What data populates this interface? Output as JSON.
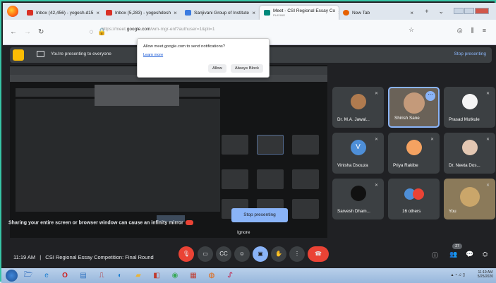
{
  "browser": {
    "tabs": [
      {
        "label": "Inbox (42,456) - yogesh.d15",
        "color": "#d93025"
      },
      {
        "label": "Inbox (5,283) - yogeshdesh",
        "color": "#d93025"
      },
      {
        "label": "Sanjivani Group of Institute",
        "color": "#3b7be0"
      },
      {
        "label": "Meet - CSI Regional Essay Co",
        "sub": "PLAYING",
        "color": "#00897b"
      },
      {
        "label": "New Tab",
        "color": "#e66000"
      }
    ],
    "url_prefix": "https://meet.",
    "url_domain": "google.com",
    "url_suffix": "/wm-mgr-enf?authuser=1&pli=1"
  },
  "notification": {
    "question": "Allow meet.google.com to send notifications?",
    "learn_more": "Learn more",
    "allow": "Allow",
    "always_block": "Always Block"
  },
  "banner": {
    "text": "You're presenting to everyone",
    "stop": "Stop presenting"
  },
  "share": {
    "warning": "Sharing your entire screen or browser window can cause an infinity mirror",
    "stop_button": "Stop presenting",
    "ignore": "Ignore"
  },
  "participants": [
    {
      "name": "Dr. M.A. Jawal...",
      "av": "#b07b4f"
    },
    {
      "name": "Shirish Sane",
      "av": "#c49a7a",
      "selected": true
    },
    {
      "name": "Prasad Mutkule",
      "av": "#f5f5f5"
    },
    {
      "name": "Vinisha Dsouza",
      "av": "#4e8fd8",
      "initial": "V"
    },
    {
      "name": "Priya Rakibe",
      "av": "#f4a261"
    },
    {
      "name": "Dr. Neeta Dos...",
      "av": "#e3c7b2"
    },
    {
      "name": "Sarvesh Dham...",
      "av": "#111111"
    },
    {
      "name": "16 others",
      "av": "#3c4043"
    },
    {
      "name": "You",
      "av": "#caa66a"
    }
  ],
  "bottom": {
    "time": "11:19 AM",
    "separator": "|",
    "meeting": "CSI Regional Essay Competition: Final Round",
    "badge": "27"
  },
  "taskbar": {
    "time": "11:19 AM",
    "date": "5/25/2020"
  }
}
